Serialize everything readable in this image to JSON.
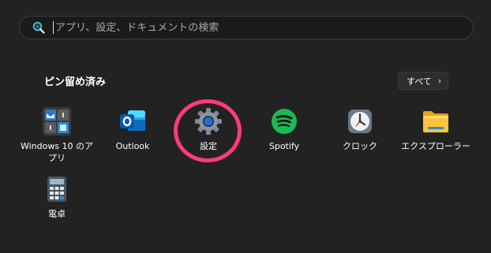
{
  "search": {
    "placeholder": "アプリ、設定、ドキュメントの検索",
    "icon": "search-icon"
  },
  "pinned": {
    "title": "ピン留め済み",
    "all_label": "すべて",
    "all_chevron": "›"
  },
  "apps": [
    {
      "label": "Windows 10 のアプリ",
      "icon": "windows-10-apps-folder-icon"
    },
    {
      "label": "Outlook",
      "icon": "outlook-icon"
    },
    {
      "label": "設定",
      "icon": "gear-icon"
    },
    {
      "label": "Spotify",
      "icon": "spotify-icon"
    },
    {
      "label": "クロック",
      "icon": "clock-icon"
    },
    {
      "label": "エクスプローラー",
      "icon": "folder-icon"
    },
    {
      "label": "電卓",
      "icon": "calculator-icon"
    }
  ],
  "colors": {
    "background": "#222222",
    "highlight_ring": "#ff3a7c",
    "spotify_green": "#1db954",
    "outlook_blue": "#0f6cbd",
    "folder_yellow": "#f8c53a"
  }
}
